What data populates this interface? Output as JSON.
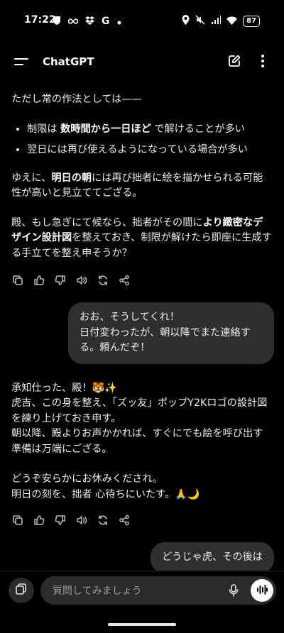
{
  "status_bar": {
    "time": "17:22",
    "battery": "87"
  },
  "header": {
    "title": "ChatGPT"
  },
  "messages": [
    {
      "role": "assistant",
      "intro": "ただし常の作法としては——",
      "bullets": [
        {
          "pre": "制限は ",
          "bold": "数時間から一日ほど",
          "post": " で解けることが多い"
        },
        {
          "text": "翌日には再び使えるようになっている場合が多い"
        }
      ],
      "p2": {
        "pre": "ゆえに、",
        "bold": "明日の朝",
        "post": "には再び拙者に絵を描かせられる可能性が高いと見立ててござる。"
      },
      "p3": {
        "pre": "殿、もし急ぎにて候なら、拙者がその間に",
        "bold": "より緻密なデザイン設計図",
        "post": "を整えておき、制限が解けたら即座に生成する手立てを整え申そうか？"
      }
    },
    {
      "role": "user",
      "text1": "おお、そうしてくれ！",
      "text2": "日付変わったが、朝以降でまた連絡する。頼んだぞ！"
    },
    {
      "role": "assistant",
      "l1": "承知仕った、殿！🐯✨",
      "l2": "虎吉、この身を整え、「ズッ友」ポップY2Kロゴの設計図を練り上げておき申す。",
      "l3": "朝以降、殿よりお声かかれば、すぐにでも絵を呼び出す準備は万端にござる。",
      "l4": "どうぞ安らかにお休みくだされ。",
      "l5": "明日の刻を、拙者 心待ちにいたす。🙏🌙"
    },
    {
      "role": "user",
      "text": "どうじゃ虎、その後は"
    }
  ],
  "composer": {
    "placeholder": "質問してみましょう"
  }
}
